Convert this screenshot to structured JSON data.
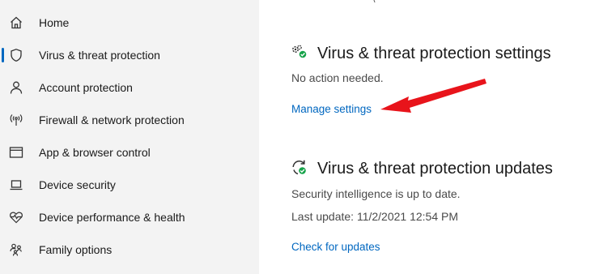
{
  "sidebar": {
    "items": [
      {
        "label": "Home",
        "icon": "home-icon"
      },
      {
        "label": "Virus & threat protection",
        "icon": "shield-icon",
        "active": true
      },
      {
        "label": "Account protection",
        "icon": "person-icon"
      },
      {
        "label": "Firewall & network protection",
        "icon": "antenna-icon"
      },
      {
        "label": "App & browser control",
        "icon": "browser-window-icon"
      },
      {
        "label": "Device security",
        "icon": "laptop-icon"
      },
      {
        "label": "Device performance & health",
        "icon": "heart-pulse-icon"
      },
      {
        "label": "Family options",
        "icon": "family-icon"
      }
    ],
    "accent": "#0067c0"
  },
  "settings_section": {
    "title": "Virus & threat protection settings",
    "status": "No action needed.",
    "link": "Manage settings",
    "icon": "gears-check-icon"
  },
  "updates_section": {
    "title": "Virus & threat protection updates",
    "status": "Security intelligence is up to date.",
    "last_update": "Last update: 11/2/2021 12:54 PM",
    "link": "Check for updates",
    "icon": "refresh-check-icon"
  },
  "annotation": {
    "arrow_color": "#e8141b",
    "icon": "red-arrow-pointer"
  },
  "colors": {
    "link": "#0067c0",
    "status_ok": "#16a34a",
    "sidebar_bg": "#f3f3f3"
  }
}
